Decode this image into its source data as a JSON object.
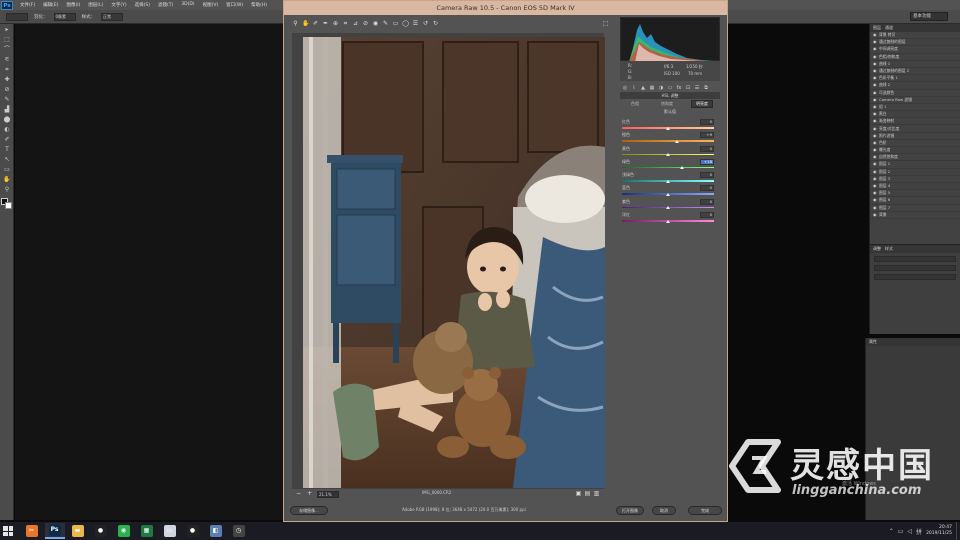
{
  "photoshop": {
    "logo": "Ps",
    "menu": [
      "文件(F)",
      "编辑(E)",
      "图像(I)",
      "图层(L)",
      "文字(Y)",
      "选择(S)",
      "滤镜(T)",
      "3D(D)",
      "视图(V)",
      "窗口(W)",
      "帮助(H)"
    ],
    "workspace": "基本功能",
    "options": [
      "羽化：",
      "0像素",
      "样式：",
      "正常"
    ],
    "tools": [
      "▸",
      "⬚",
      "⌒",
      "⚟",
      "⌗",
      "✚",
      "⊘",
      "✎",
      "▟",
      "⬤",
      "◐",
      "✐",
      "T",
      "↖",
      "▭",
      "✋",
      "⚲"
    ],
    "layer_tabs": [
      "图层",
      "通道"
    ],
    "layers": [
      "背景 拷贝",
      "通过复制的图层",
      "中间调亮度",
      "色相/饱和度",
      "曲线 1",
      "通过复制的图层 2",
      "色彩平衡 1",
      "曲线 2",
      "可选颜色",
      "Camera Raw 滤镜",
      "组 1",
      "黑白",
      "渐变映射",
      "亮度/对比度",
      "照片滤镜",
      "色阶",
      "曝光度",
      "自然饱和度",
      "图层 1",
      "图层 2",
      "图层 3",
      "图层 4",
      "图层 5",
      "图层 6",
      "图层 7",
      "背景"
    ],
    "adjust_tabs": [
      "调整",
      "样式"
    ],
    "props_tab": "属性"
  },
  "acr": {
    "title": "Camera Raw 10.5 -  Canon EOS 5D Mark IV",
    "toolbar_icons": [
      "zoom-icon",
      "hand-icon",
      "white-balance-icon",
      "color-sampler-icon",
      "target-adjust-icon",
      "crop-icon",
      "straighten-icon",
      "spot-removal-icon",
      "red-eye-icon",
      "brush-icon",
      "graduated-filter-icon",
      "radial-filter-icon",
      "preferences-icon",
      "rotate-left-icon",
      "rotate-right-icon"
    ],
    "exif": [
      "f/6.3",
      "1/250 秒",
      "ISO 100",
      "70 mm"
    ],
    "rgb": [
      "R:",
      "G:",
      "B:"
    ],
    "hsl_header": "HSL 调整",
    "hsl_tabs": [
      "色相",
      "饱和度",
      "明亮度"
    ],
    "hsl_active_tab": 2,
    "hsl_subtitle": "默认值",
    "sliders": [
      {
        "label": "红色",
        "value": "0",
        "position": 0.5,
        "colors": [
          "#ff5b5b",
          "#ffd0a0"
        ]
      },
      {
        "label": "橙色",
        "value": "+9",
        "position": 0.6,
        "colors": [
          "#b25f10",
          "#ffb45a"
        ]
      },
      {
        "label": "黄色",
        "value": "0",
        "position": 0.5,
        "colors": [
          "#8a8a10",
          "#ffff70"
        ]
      },
      {
        "label": "绿色",
        "value": "+18",
        "position": 0.65,
        "colors": [
          "#1a6a1a",
          "#8aff8a"
        ],
        "active": true
      },
      {
        "label": "浅绿色",
        "value": "0",
        "position": 0.5,
        "colors": [
          "#157070",
          "#8affff"
        ]
      },
      {
        "label": "蓝色",
        "value": "0",
        "position": 0.5,
        "colors": [
          "#18307a",
          "#8aa8ff"
        ]
      },
      {
        "label": "紫色",
        "value": "0",
        "position": 0.5,
        "colors": [
          "#4a1a7a",
          "#c890ff"
        ]
      },
      {
        "label": "洋红",
        "value": "0",
        "position": 0.5,
        "colors": [
          "#7a1a60",
          "#ff8ae0"
        ]
      }
    ],
    "zoom": "21.1%",
    "filename": "IMG_0000.CR2",
    "file_info": "Adobe RGB (1998); 8 位; 3648 x 5472 (20.0 百万像素); 300 ppi",
    "buttons": {
      "save": "存储图像...",
      "open": "打开图像",
      "cancel": "取消",
      "done": "完成"
    }
  },
  "watermark": {
    "title": "灵感中国",
    "url": "lingganchina.com",
    "os_note": "激活 Windows"
  },
  "taskbar": {
    "apps": [
      {
        "name": "tool-app",
        "label": "✂",
        "color": "#e8762c"
      },
      {
        "name": "photoshop-app",
        "label": "Ps",
        "color": "#0c2b49",
        "active": true
      },
      {
        "name": "explorer-app",
        "label": "▬",
        "color": "#e8b84a"
      },
      {
        "name": "qq-app",
        "label": "●",
        "color": "#222"
      },
      {
        "name": "wechat-app",
        "label": "◉",
        "color": "#2bb24c"
      },
      {
        "name": "excel-app",
        "label": "▦",
        "color": "#1e7a3e"
      },
      {
        "name": "window-app",
        "label": "▭",
        "color": "#cfd6df"
      },
      {
        "name": "qq2-app",
        "label": "●",
        "color": "#222"
      },
      {
        "name": "photos-app",
        "label": "◧",
        "color": "#5a7fb0"
      },
      {
        "name": "clock-app",
        "label": "◷",
        "color": "#444"
      }
    ],
    "time": "20:47",
    "date": "2019/11/25",
    "ime": "拼"
  },
  "colors": {
    "title_bar": "#d9b7a0",
    "accent": "#4a78c0"
  }
}
